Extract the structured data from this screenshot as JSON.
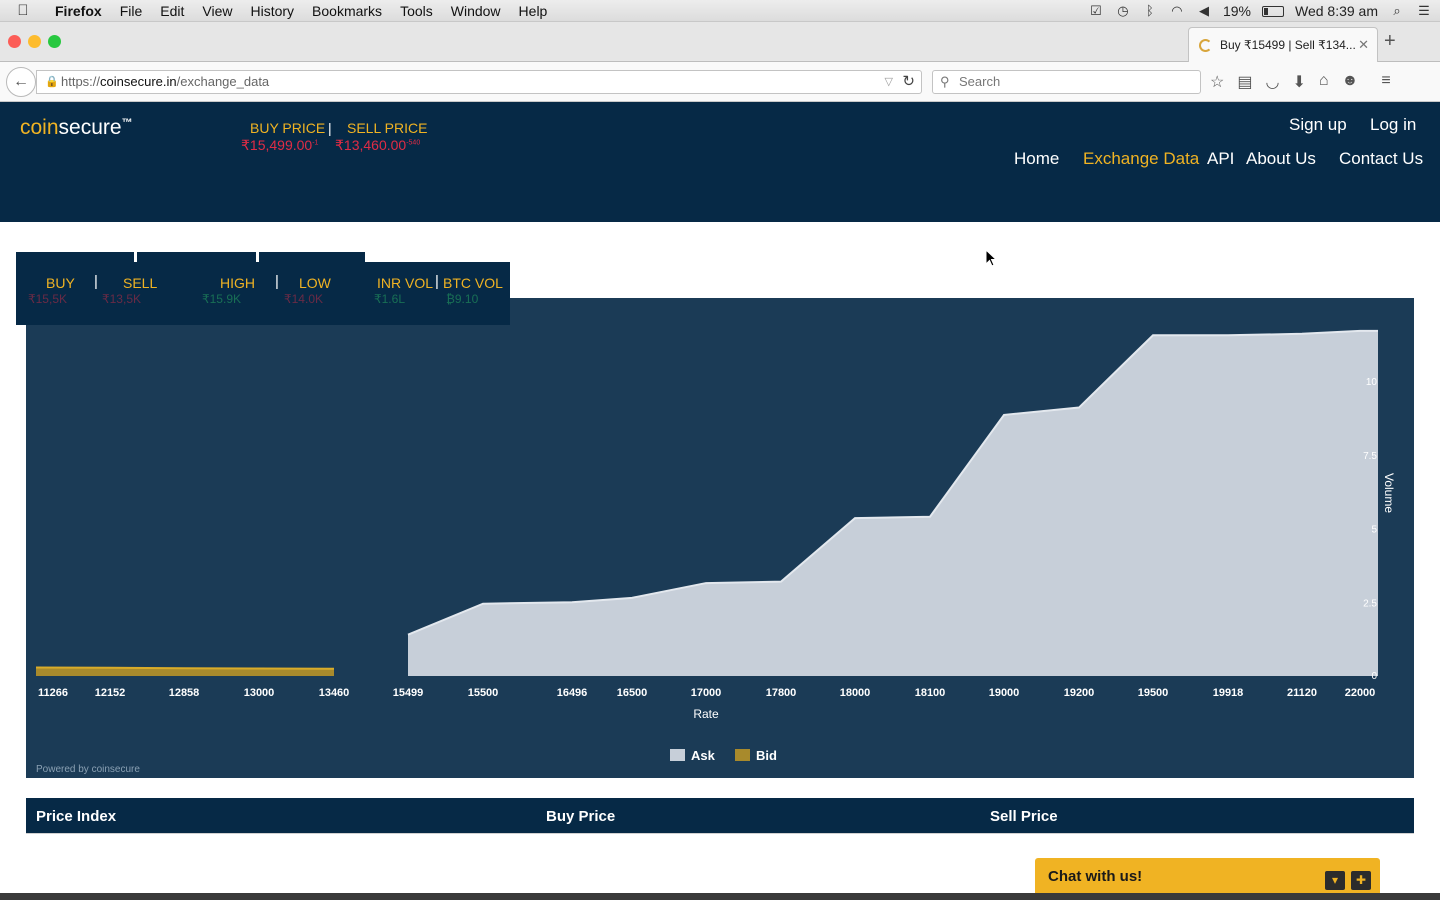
{
  "menubar": {
    "app": "Firefox",
    "items": [
      "File",
      "Edit",
      "View",
      "History",
      "Bookmarks",
      "Tools",
      "Window",
      "Help"
    ],
    "battery": "19%",
    "clock": "Wed 8:39 am"
  },
  "browser": {
    "tab_title": "Buy ₹15499 | Sell ₹134...",
    "url_prefix": "https://",
    "url_host": "coinsecure.in",
    "url_path": "/exchange_data",
    "search_placeholder": "Search"
  },
  "site": {
    "logo_coin": "coin",
    "logo_secure": "secure",
    "logo_tm": "™",
    "buy_label": "BUY PRICE",
    "sell_label": "SELL PRICE",
    "buy_value": "₹15,499.00",
    "buy_change": "-1",
    "sell_value": "₹13,460.00",
    "sell_change": "-540",
    "signup": "Sign up",
    "login": "Log in",
    "nav": [
      "Home",
      "Exchange Data",
      "API",
      "About Us",
      "Contact Us"
    ],
    "nav_active": "Exchange Data"
  },
  "ticker": {
    "labels": [
      "BUY",
      "SELL",
      "HIGH",
      "LOW",
      "INR VOL",
      "BTC VOL"
    ],
    "values": [
      "₹15,5K",
      "₹13,5K",
      "₹15.9K",
      "₹14.0K",
      "₹1.6L",
      "₿9.10"
    ]
  },
  "chart_data": {
    "type": "area",
    "xlabel": "Rate",
    "ylabel": "Volume",
    "ylim": [
      0,
      11.6
    ],
    "yticks": [
      0,
      2.5,
      5,
      7.5,
      10
    ],
    "categories": [
      "11266",
      "12152",
      "12858",
      "13000",
      "13460",
      "15499",
      "15500",
      "16496",
      "16500",
      "17000",
      "17800",
      "18000",
      "18100",
      "19000",
      "19200",
      "19500",
      "19918",
      "21120",
      "22000"
    ],
    "series": [
      {
        "name": "Bid",
        "color": "#a88a2c",
        "x": [
          "11266",
          "12152",
          "12858",
          "13000",
          "13460"
        ],
        "values": [
          0.3,
          0.25,
          0.15,
          0.1,
          0.05
        ]
      },
      {
        "name": "Ask",
        "color": "#c7cfd9",
        "x": [
          "15499",
          "15500",
          "16496",
          "16500",
          "17000",
          "17800",
          "18000",
          "18100",
          "19000",
          "19200",
          "19500",
          "19918",
          "21120",
          "22000"
        ],
        "values": [
          1.4,
          2.45,
          2.5,
          2.65,
          3.15,
          3.2,
          5.35,
          5.4,
          8.85,
          9.1,
          11.55,
          11.55,
          11.6,
          11.7
        ]
      }
    ],
    "legend": "bottom-center",
    "grid": false,
    "footer": "Powered by coinsecure"
  },
  "table": {
    "headers": [
      "Price Index",
      "Buy Price",
      "Sell Price"
    ]
  },
  "chat": {
    "label": "Chat with us!",
    "min_icon": "chevron-down-icon",
    "expand_icon": "plus-icon"
  },
  "colors": {
    "brand_dark": "#062946",
    "accent": "#f0b323",
    "sell_red": "#e02c45",
    "chart_bg": "#1b3b56"
  }
}
